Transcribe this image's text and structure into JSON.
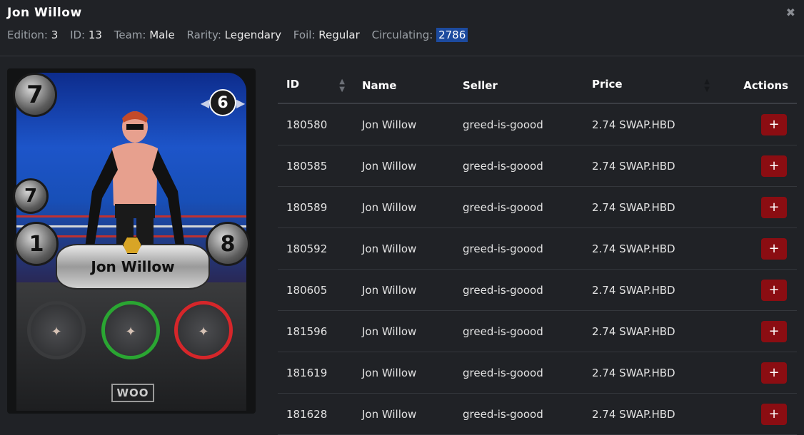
{
  "header": {
    "title": "Jon Willow",
    "close_symbol": "✖"
  },
  "meta": [
    {
      "label": "Edition:",
      "value": "3"
    },
    {
      "label": "ID:",
      "value": "13"
    },
    {
      "label": "Team:",
      "value": "Male"
    },
    {
      "label": "Rarity:",
      "value": "Legendary"
    },
    {
      "label": "Foil:",
      "value": "Regular"
    },
    {
      "label": "Circulating:",
      "value": "2786"
    }
  ],
  "card": {
    "name": "Jon Willow",
    "mana": "7",
    "level": "6",
    "speed": "7",
    "attack": "1",
    "health": "8",
    "edition_badge": "WOO"
  },
  "table": {
    "columns": [
      "ID",
      "Name",
      "Seller",
      "Price",
      "Actions"
    ],
    "add_symbol": "+",
    "rows": [
      {
        "id": "180580",
        "name": "Jon Willow",
        "seller": "greed-is-goood",
        "price": "2.74 SWAP.HBD"
      },
      {
        "id": "180585",
        "name": "Jon Willow",
        "seller": "greed-is-goood",
        "price": "2.74 SWAP.HBD"
      },
      {
        "id": "180589",
        "name": "Jon Willow",
        "seller": "greed-is-goood",
        "price": "2.74 SWAP.HBD"
      },
      {
        "id": "180592",
        "name": "Jon Willow",
        "seller": "greed-is-goood",
        "price": "2.74 SWAP.HBD"
      },
      {
        "id": "180605",
        "name": "Jon Willow",
        "seller": "greed-is-goood",
        "price": "2.74 SWAP.HBD"
      },
      {
        "id": "181596",
        "name": "Jon Willow",
        "seller": "greed-is-goood",
        "price": "2.74 SWAP.HBD"
      },
      {
        "id": "181619",
        "name": "Jon Willow",
        "seller": "greed-is-goood",
        "price": "2.74 SWAP.HBD"
      },
      {
        "id": "181628",
        "name": "Jon Willow",
        "seller": "greed-is-goood",
        "price": "2.74 SWAP.HBD"
      }
    ]
  },
  "colors": {
    "background": "#202226",
    "add_button": "#8b0d12",
    "highlight": "#1c4a9e"
  }
}
